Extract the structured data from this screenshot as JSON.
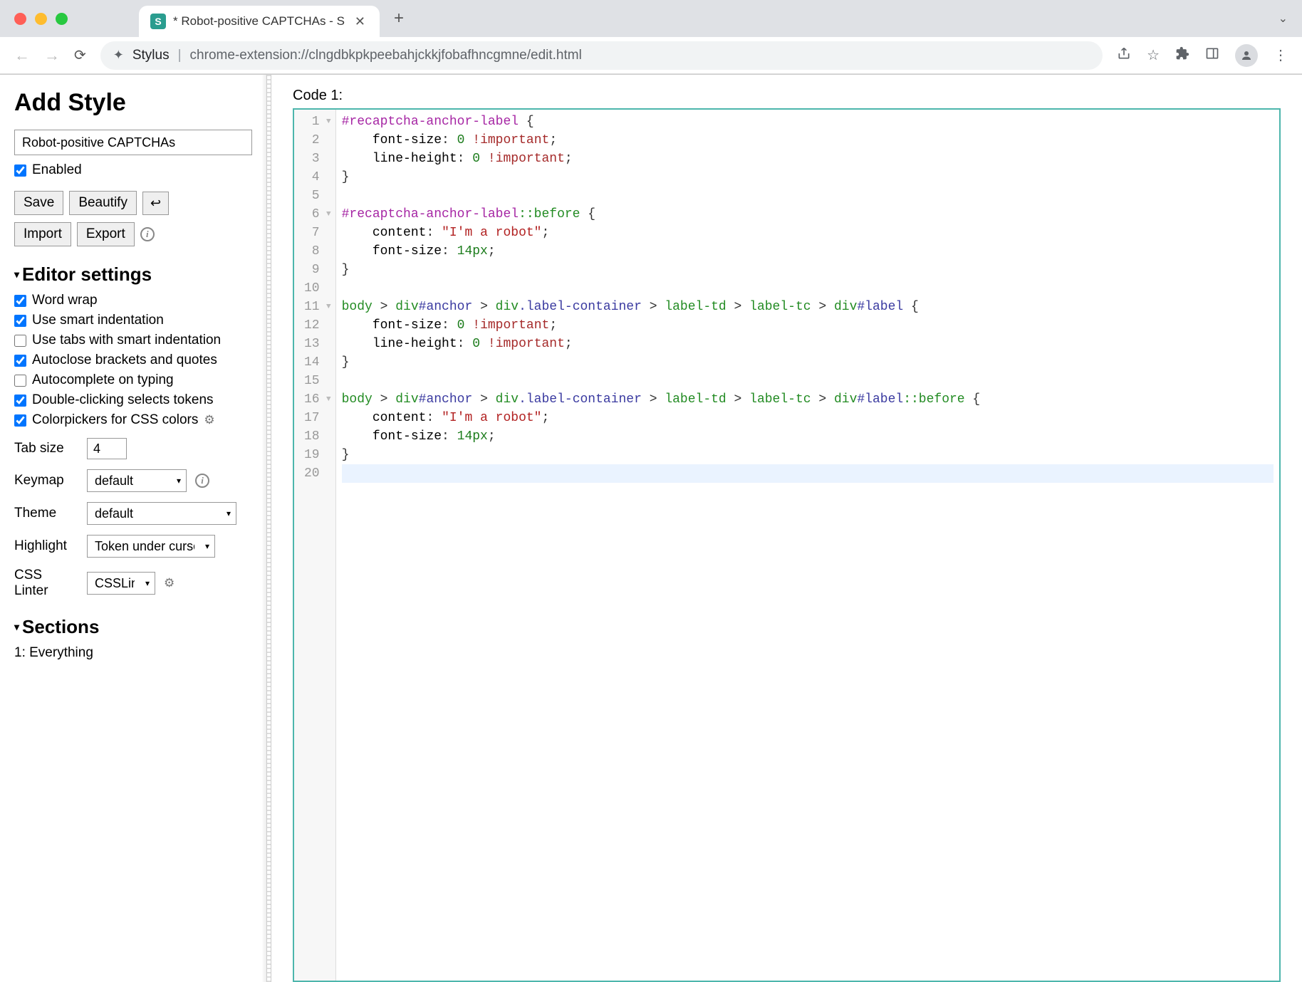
{
  "tab": {
    "title": "* Robot-positive CAPTCHAs - S",
    "favicon_letter": "S"
  },
  "address": {
    "prefix": "Stylus",
    "url": "chrome-extension://clngdbkpkpeebahjckkjfobafhncgmne/edit.html"
  },
  "sidebar": {
    "heading": "Add Style",
    "style_name": "Robot-positive CAPTCHAs",
    "enabled_label": "Enabled",
    "buttons": {
      "save": "Save",
      "beautify": "Beautify",
      "wrap": "↩",
      "import": "Import",
      "export": "Export"
    },
    "editor_settings_heading": "Editor settings",
    "settings": [
      {
        "label": "Word wrap",
        "checked": true
      },
      {
        "label": "Use smart indentation",
        "checked": true
      },
      {
        "label": "Use tabs with smart indentation",
        "checked": false
      },
      {
        "label": "Autoclose brackets and quotes",
        "checked": true
      },
      {
        "label": "Autocomplete on typing",
        "checked": false
      },
      {
        "label": "Double-clicking selects tokens",
        "checked": true
      },
      {
        "label": "Colorpickers for CSS colors",
        "checked": true,
        "gear": true
      }
    ],
    "tab_size": {
      "label": "Tab size",
      "value": "4"
    },
    "keymap": {
      "label": "Keymap",
      "value": "default"
    },
    "theme": {
      "label": "Theme",
      "value": "default"
    },
    "highlight": {
      "label": "Highlight",
      "value": "Token under cursor"
    },
    "linter": {
      "label": "CSS Linter",
      "value": "CSSLint"
    },
    "sections_heading": "Sections",
    "sections": [
      "1: Everything"
    ]
  },
  "code": {
    "label": "Code 1:",
    "lines": [
      {
        "n": 1,
        "fold": true,
        "tokens": [
          [
            "sel",
            "#recaptcha-anchor-label"
          ],
          [
            "punct",
            " {"
          ]
        ]
      },
      {
        "n": 2,
        "tokens": [
          [
            "ws",
            "    "
          ],
          [
            "prop",
            "font-size"
          ],
          [
            "punct",
            ": "
          ],
          [
            "num",
            "0"
          ],
          [
            "punct",
            " "
          ],
          [
            "kw",
            "!important"
          ],
          [
            "punct",
            ";"
          ]
        ]
      },
      {
        "n": 3,
        "tokens": [
          [
            "ws",
            "    "
          ],
          [
            "prop",
            "line-height"
          ],
          [
            "punct",
            ": "
          ],
          [
            "num",
            "0"
          ],
          [
            "punct",
            " "
          ],
          [
            "kw",
            "!important"
          ],
          [
            "punct",
            ";"
          ]
        ]
      },
      {
        "n": 4,
        "tokens": [
          [
            "punct",
            "}"
          ]
        ]
      },
      {
        "n": 5,
        "tokens": []
      },
      {
        "n": 6,
        "fold": true,
        "tokens": [
          [
            "sel",
            "#recaptcha-anchor-label"
          ],
          [
            "pseudo",
            "::before"
          ],
          [
            "punct",
            " {"
          ]
        ]
      },
      {
        "n": 7,
        "tokens": [
          [
            "ws",
            "    "
          ],
          [
            "prop",
            "content"
          ],
          [
            "punct",
            ": "
          ],
          [
            "str",
            "\"I'm a robot\""
          ],
          [
            "punct",
            ";"
          ]
        ]
      },
      {
        "n": 8,
        "tokens": [
          [
            "ws",
            "    "
          ],
          [
            "prop",
            "font-size"
          ],
          [
            "punct",
            ": "
          ],
          [
            "num",
            "14px"
          ],
          [
            "punct",
            ";"
          ]
        ]
      },
      {
        "n": 9,
        "tokens": [
          [
            "punct",
            "}"
          ]
        ]
      },
      {
        "n": 10,
        "tokens": []
      },
      {
        "n": 11,
        "fold": true,
        "tokens": [
          [
            "tag",
            "body"
          ],
          [
            "punct",
            " > "
          ],
          [
            "tag",
            "div"
          ],
          [
            "id",
            "#anchor"
          ],
          [
            "punct",
            " > "
          ],
          [
            "tag",
            "div"
          ],
          [
            "class",
            ".label-container"
          ],
          [
            "punct",
            " > "
          ],
          [
            "tag",
            "label-td"
          ],
          [
            "punct",
            " > "
          ],
          [
            "tag",
            "label-tc"
          ],
          [
            "punct",
            " > "
          ],
          [
            "tag",
            "div"
          ],
          [
            "id",
            "#label"
          ],
          [
            "punct",
            " {"
          ]
        ]
      },
      {
        "n": 12,
        "tokens": [
          [
            "ws",
            "    "
          ],
          [
            "prop",
            "font-size"
          ],
          [
            "punct",
            ": "
          ],
          [
            "num",
            "0"
          ],
          [
            "punct",
            " "
          ],
          [
            "kw",
            "!important"
          ],
          [
            "punct",
            ";"
          ]
        ]
      },
      {
        "n": 13,
        "tokens": [
          [
            "ws",
            "    "
          ],
          [
            "prop",
            "line-height"
          ],
          [
            "punct",
            ": "
          ],
          [
            "num",
            "0"
          ],
          [
            "punct",
            " "
          ],
          [
            "kw",
            "!important"
          ],
          [
            "punct",
            ";"
          ]
        ]
      },
      {
        "n": 14,
        "tokens": [
          [
            "punct",
            "}"
          ]
        ]
      },
      {
        "n": 15,
        "tokens": []
      },
      {
        "n": 16,
        "fold": true,
        "tokens": [
          [
            "tag",
            "body"
          ],
          [
            "punct",
            " > "
          ],
          [
            "tag",
            "div"
          ],
          [
            "id",
            "#anchor"
          ],
          [
            "punct",
            " > "
          ],
          [
            "tag",
            "div"
          ],
          [
            "class",
            ".label-container"
          ],
          [
            "punct",
            " > "
          ],
          [
            "tag",
            "label-td"
          ],
          [
            "punct",
            " > "
          ],
          [
            "tag",
            "label-tc"
          ],
          [
            "punct",
            " > "
          ],
          [
            "tag",
            "div"
          ],
          [
            "id",
            "#label"
          ],
          [
            "pseudo",
            "::before"
          ],
          [
            "punct",
            " {"
          ]
        ]
      },
      {
        "n": 17,
        "tokens": [
          [
            "ws",
            "    "
          ],
          [
            "prop",
            "content"
          ],
          [
            "punct",
            ": "
          ],
          [
            "str",
            "\"I'm a robot\""
          ],
          [
            "punct",
            ";"
          ]
        ]
      },
      {
        "n": 18,
        "tokens": [
          [
            "ws",
            "    "
          ],
          [
            "prop",
            "font-size"
          ],
          [
            "punct",
            ": "
          ],
          [
            "num",
            "14px"
          ],
          [
            "punct",
            ";"
          ]
        ]
      },
      {
        "n": 19,
        "tokens": [
          [
            "punct",
            "}"
          ]
        ]
      },
      {
        "n": 20,
        "active": true,
        "tokens": []
      }
    ]
  }
}
